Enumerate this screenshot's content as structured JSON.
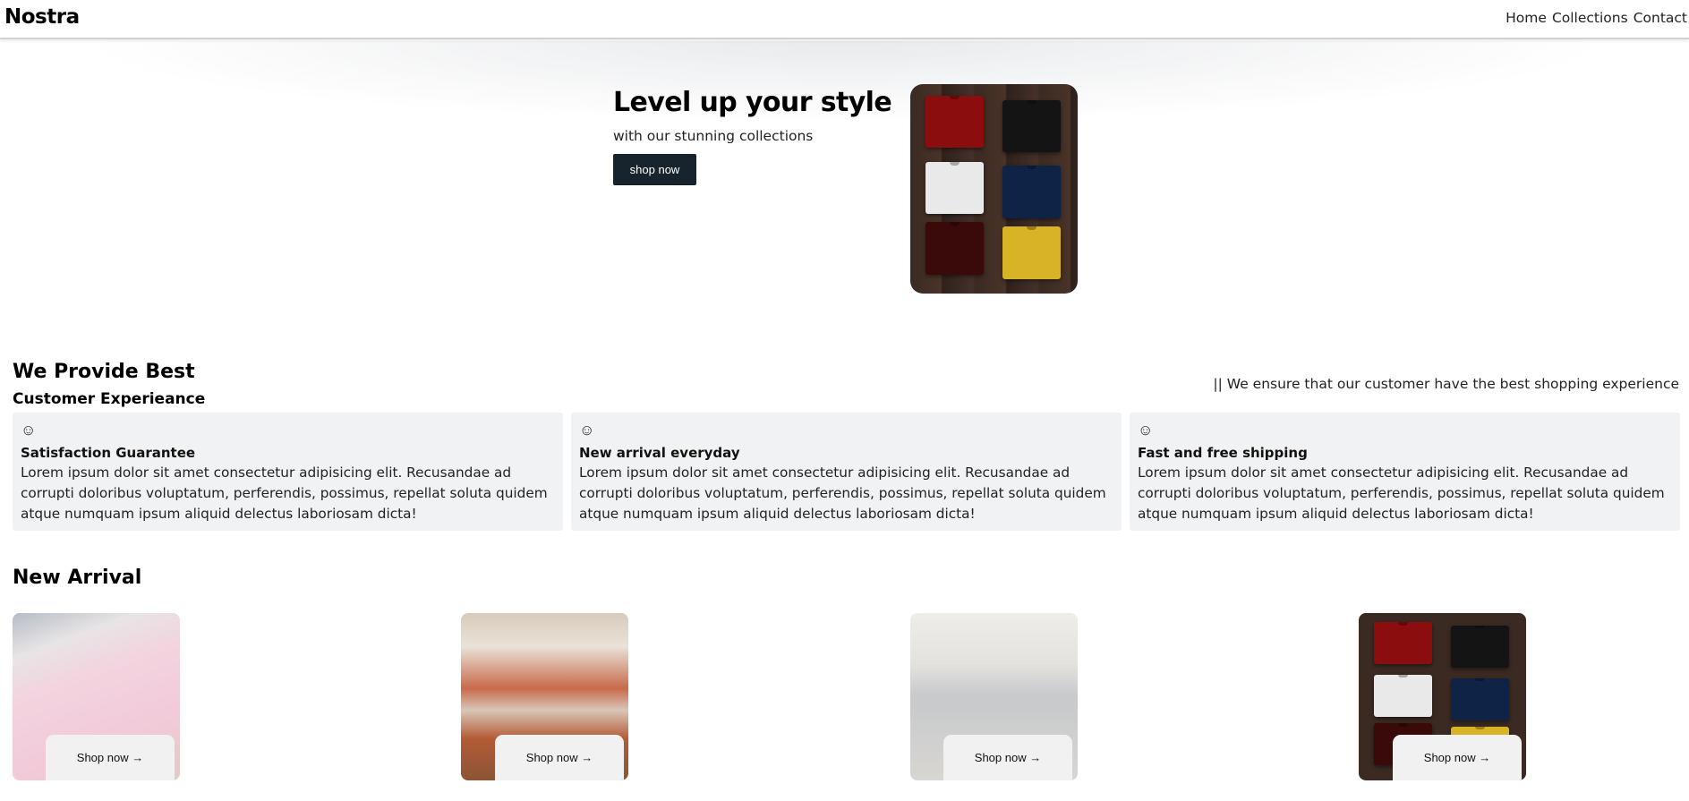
{
  "navbar": {
    "brand": "Nostra",
    "links": [
      {
        "label": "Home"
      },
      {
        "label": "Collections"
      },
      {
        "label": "Contact"
      }
    ]
  },
  "hero": {
    "title": "Level up your style",
    "subtitle": "with our stunning collections",
    "button_label": "shop now"
  },
  "features_section": {
    "title": "We Provide Best",
    "subtitle": "Customer Experieance",
    "tagline": "|| We ensure that our customer have the best shopping experience",
    "cards": [
      {
        "icon": "smile-icon",
        "title": "Satisfaction Guarantee",
        "text": "Lorem ipsum dolor sit amet consectetur adipisicing elit. Recusandae ad corrupti doloribus voluptatum, perferendis, possimus, repellat soluta quidem atque numquam ipsum aliquid delectus laboriosam dicta!"
      },
      {
        "icon": "smile-icon",
        "title": "New arrival everyday",
        "text": "Lorem ipsum dolor sit amet consectetur adipisicing elit. Recusandae ad corrupti doloribus voluptatum, perferendis, possimus, repellat soluta quidem atque numquam ipsum aliquid delectus laboriosam dicta!"
      },
      {
        "icon": "smile-icon",
        "title": "Fast and free shipping",
        "text": "Lorem ipsum dolor sit amet consectetur adipisicing elit. Recusandae ad corrupti doloribus voluptatum, perferendis, possimus, repellat soluta quidem atque numquam ipsum aliquid delectus laboriosam dicta!"
      }
    ]
  },
  "new_arrival": {
    "title": "New Arrival",
    "products": [
      {
        "button_label": "Shop now →"
      },
      {
        "button_label": "Shop now →"
      },
      {
        "button_label": "Shop now →"
      },
      {
        "button_label": "Shop now →"
      }
    ]
  },
  "colors": {
    "hero_button_bg": "#17242d",
    "card_bg": "#f1f2f4",
    "tee_colors": [
      "#8b0d0d",
      "#141414",
      "#e9e9e9",
      "#0f2346",
      "#3a0a0a",
      "#d8b325"
    ]
  }
}
